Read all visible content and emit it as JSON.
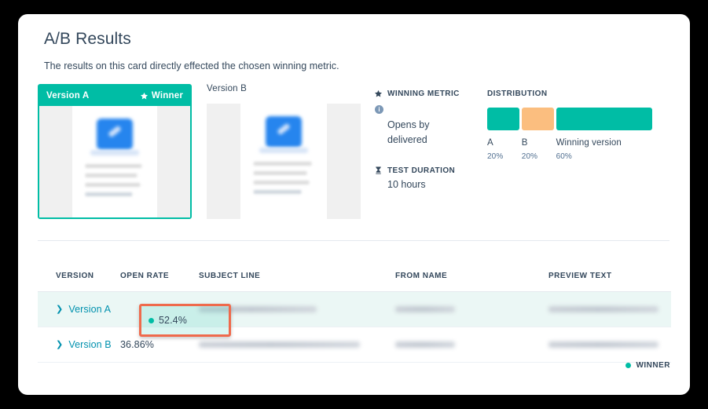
{
  "page": {
    "title": "A/B Results",
    "subtitle": "The results on this card directly effected the chosen winning metric."
  },
  "versions": {
    "a": {
      "label": "Version A",
      "winner_label": "Winner",
      "is_winner": true
    },
    "b": {
      "label": "Version B",
      "is_winner": false
    }
  },
  "metrics": {
    "winning_metric": {
      "heading": "WINNING METRIC",
      "value": "Opens by delivered",
      "info": "i"
    },
    "test_duration": {
      "heading": "TEST DURATION",
      "value": "10 hours"
    }
  },
  "distribution": {
    "title": "DISTRIBUTION",
    "segments": [
      {
        "name": "A",
        "pct_label": "20%",
        "pct": 20,
        "color": "#00bda5"
      },
      {
        "name": "B",
        "pct_label": "20%",
        "pct": 20,
        "color": "#fbbe7f"
      },
      {
        "name": "Winning version",
        "pct_label": "60%",
        "pct": 60,
        "color": "#00bda5"
      }
    ]
  },
  "table": {
    "columns": [
      "VERSION",
      "OPEN RATE",
      "SUBJECT LINE",
      "FROM NAME",
      "PREVIEW TEXT"
    ],
    "rows": [
      {
        "version": "Version A",
        "open_rate": "52.4%",
        "is_winner": true,
        "highlighted": true,
        "subject_line": "",
        "from_name": "",
        "preview_text": ""
      },
      {
        "version": "Version B",
        "open_rate": "36.86%",
        "is_winner": false,
        "highlighted": false,
        "subject_line": "",
        "from_name": "",
        "preview_text": ""
      }
    ]
  },
  "legend": {
    "winner_label": "WINNER"
  },
  "colors": {
    "teal": "#00bda5",
    "orange": "#fbbe7f",
    "highlight_border": "#ef6a4c",
    "link": "#0091ae",
    "text": "#33475b",
    "winner_row_bg": "#ebf7f5"
  }
}
